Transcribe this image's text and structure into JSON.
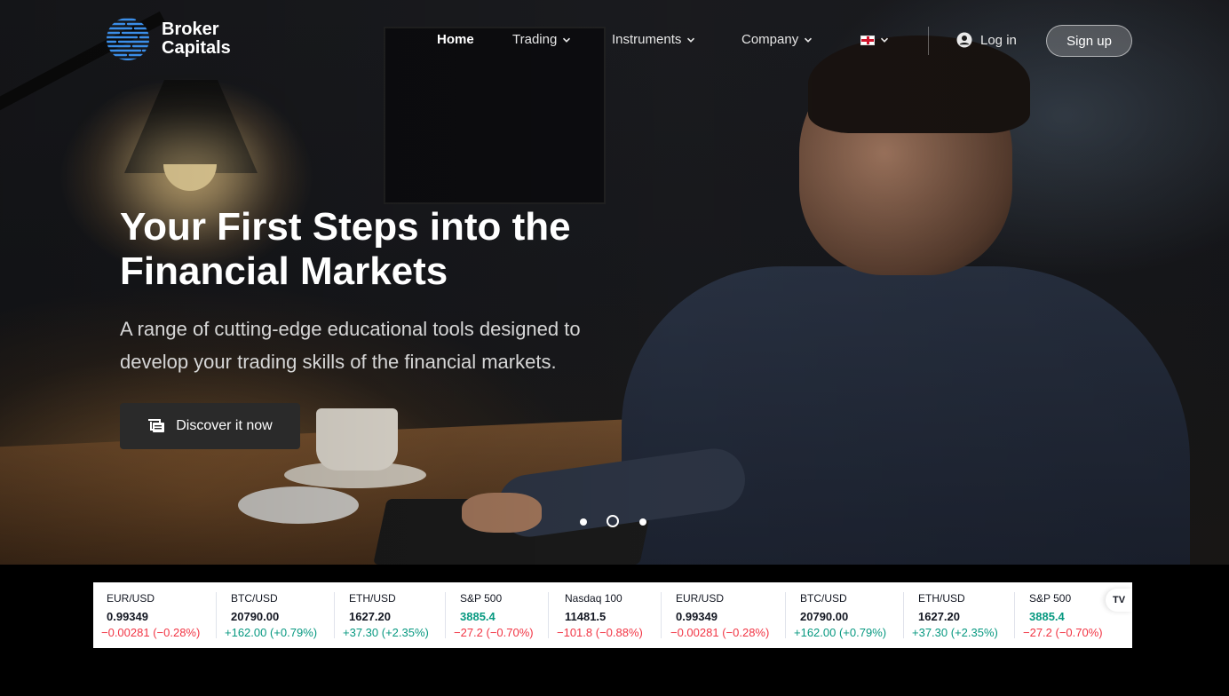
{
  "logo": {
    "line1": "Broker",
    "line2": "Capitals"
  },
  "nav": {
    "items": [
      {
        "label": "Home",
        "active": true,
        "dropdown": false
      },
      {
        "label": "Trading",
        "active": false,
        "dropdown": true
      },
      {
        "label": "Instruments",
        "active": false,
        "dropdown": true
      },
      {
        "label": "Company",
        "active": false,
        "dropdown": true
      }
    ],
    "language_icon": "england-flag-icon",
    "login_label": "Log in",
    "signup_label": "Sign up"
  },
  "hero": {
    "title_line1": "Your First Steps into the",
    "title_line2": "Financial Markets",
    "subtitle_line1": "A range of cutting-edge educational tools designed to",
    "subtitle_line2": "develop your trading skills of the financial markets.",
    "cta_label": "Discover it now",
    "carousel_active_index": 1,
    "carousel_count": 3
  },
  "ticker": {
    "items": [
      {
        "symbol": "EUR/USD",
        "price": "0.99349",
        "change": "−0.00281 (−0.28%)",
        "direction": "down",
        "price_color": "default"
      },
      {
        "symbol": "BTC/USD",
        "price": "20790.00",
        "change": "+162.00 (+0.79%)",
        "direction": "up",
        "price_color": "default"
      },
      {
        "symbol": "ETH/USD",
        "price": "1627.20",
        "change": "+37.30 (+2.35%)",
        "direction": "up",
        "price_color": "default"
      },
      {
        "symbol": "S&P 500",
        "price": "3885.4",
        "change": "−27.2 (−0.70%)",
        "direction": "down",
        "price_color": "up"
      },
      {
        "symbol": "Nasdaq 100",
        "price": "11481.5",
        "change": "−101.8 (−0.88%)",
        "direction": "down",
        "price_color": "default"
      },
      {
        "symbol": "EUR/USD",
        "price": "0.99349",
        "change": "−0.00281 (−0.28%)",
        "direction": "down",
        "price_color": "default"
      },
      {
        "symbol": "BTC/USD",
        "price": "20790.00",
        "change": "+162.00 (+0.79%)",
        "direction": "up",
        "price_color": "default"
      },
      {
        "symbol": "ETH/USD",
        "price": "1627.20",
        "change": "+37.30 (+2.35%)",
        "direction": "up",
        "price_color": "default"
      },
      {
        "symbol": "S&P 500",
        "price": "3885.4",
        "change": "−27.2 (−0.70%)",
        "direction": "down",
        "price_color": "up"
      }
    ],
    "badge_label": "TV"
  },
  "colors": {
    "up": "#089981",
    "down": "#f23645",
    "cta_background": "#2a2a2a"
  }
}
